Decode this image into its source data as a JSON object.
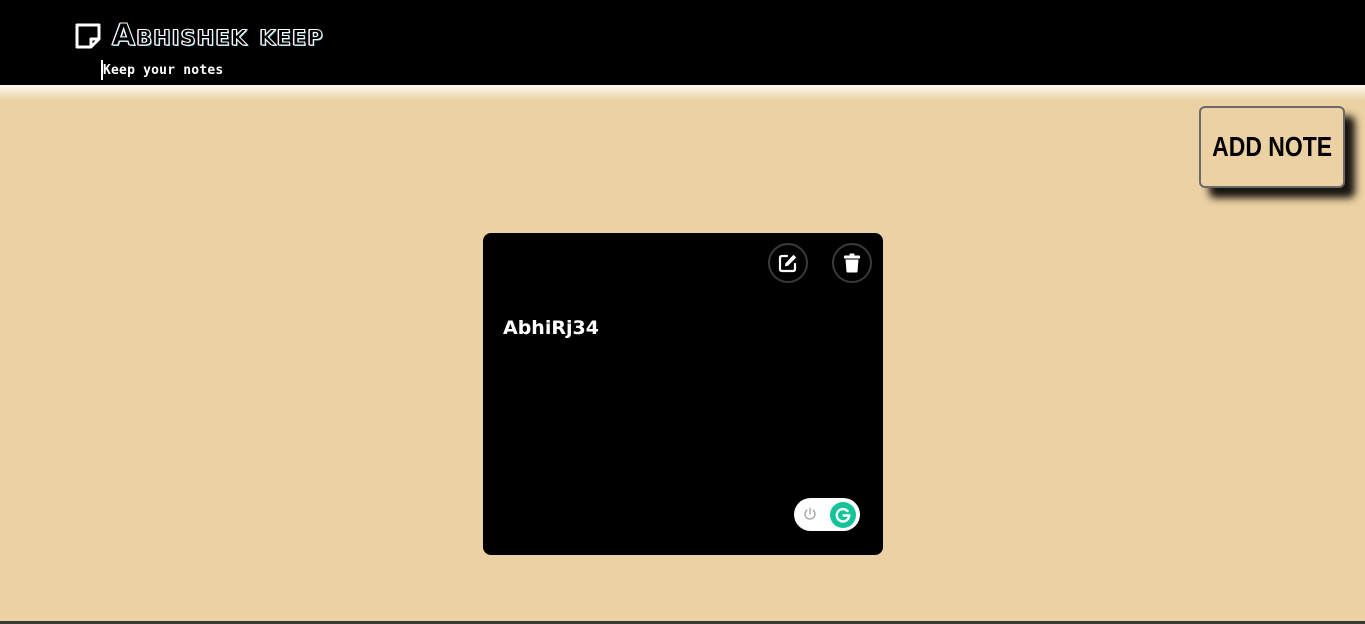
{
  "header": {
    "brand": "Abhishek keep",
    "tagline": "Keep your notes",
    "logo_icon": "sticky-note-icon"
  },
  "toolbar": {
    "add_note_label": "ADD NOTE"
  },
  "notes": [
    {
      "text": "AbhiRj34",
      "edit_icon": "edit-icon",
      "delete_icon": "trash-icon"
    }
  ],
  "grammarly": {
    "power_icon": "power-icon",
    "logo_icon": "grammarly-g-icon",
    "brand_color": "#15c39a"
  },
  "colors": {
    "background": "#ebd1a3",
    "header": "#000000",
    "card": "#000000"
  }
}
